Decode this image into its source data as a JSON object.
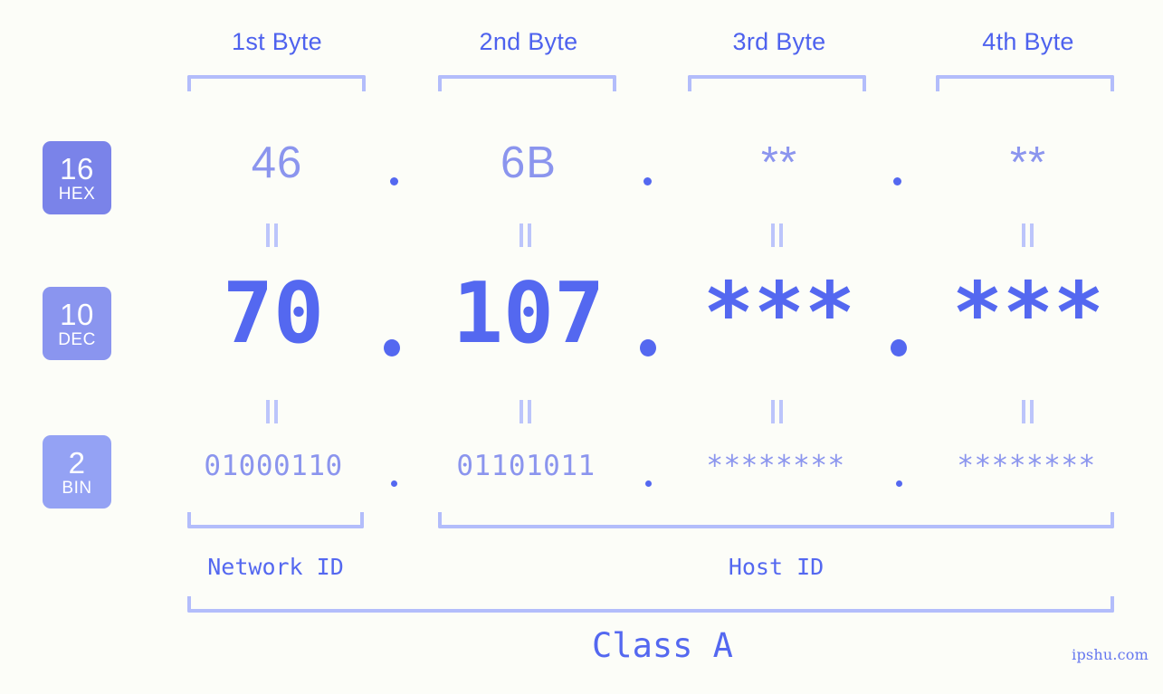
{
  "background": "#fcfdf8",
  "colors": {
    "primary": "#5468f0",
    "light": "#8b95ee",
    "bracket": "#b3bdfb",
    "eq_mark": "#bcc5fb",
    "badge_hex": "#7a83e9",
    "badge_dec": "#8a95ef",
    "badge_bin": "#94a2f4"
  },
  "headers": [
    {
      "label": "1st Byte"
    },
    {
      "label": "2nd Byte"
    },
    {
      "label": "3rd Byte"
    },
    {
      "label": "4th Byte"
    }
  ],
  "badges": [
    {
      "num": "16",
      "abbr": "HEX"
    },
    {
      "num": "10",
      "abbr": "DEC"
    },
    {
      "num": "2",
      "abbr": "BIN"
    }
  ],
  "rows": {
    "hex": {
      "radix": "16",
      "name": "HEX",
      "values": [
        "46",
        "6B",
        "**",
        "**"
      ],
      "separator": "."
    },
    "dec": {
      "radix": "10",
      "name": "DEC",
      "values": [
        "70",
        "107",
        "***",
        "***"
      ],
      "separator": "."
    },
    "bin": {
      "radix": "2",
      "name": "BIN",
      "values": [
        "01000110",
        "01101011",
        "********",
        "********"
      ],
      "separator": "."
    }
  },
  "equivalence_mark": "=",
  "segments": {
    "network_id": "Network ID",
    "host_id": "Host ID",
    "class": "Class A"
  },
  "watermark": "ipshu.com"
}
